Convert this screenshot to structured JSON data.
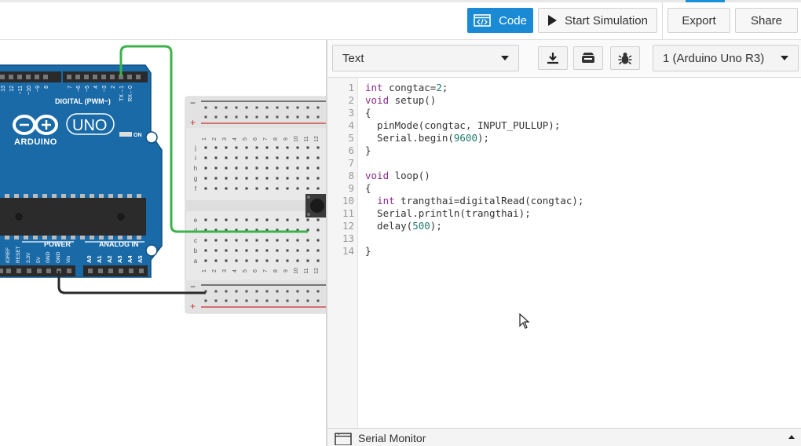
{
  "toolbar": {
    "code_label": "Code",
    "start_sim_label": "Start Simulation",
    "export_label": "Export",
    "share_label": "Share"
  },
  "editor_bar": {
    "mode_selected": "Text",
    "board_selected": "1 (Arduino Uno R3)",
    "icons": [
      "download-icon",
      "library-icon",
      "debugger-bug-icon"
    ]
  },
  "code": {
    "line_numbers": [
      "1",
      "2",
      "3",
      "4",
      "5",
      "6",
      "7",
      "8",
      "9",
      "10",
      "11",
      "12",
      "13",
      "14"
    ]
  },
  "serial_monitor": {
    "label": "Serial Monitor"
  },
  "board": {
    "logo_text": "ARDUINO",
    "model": "UNO",
    "on_label": "ON",
    "digital_label": "DIGITAL (PWM~)",
    "power_label": "POWER",
    "analog_label": "ANALOG IN",
    "digital_pins": [
      "13",
      "12",
      "~11",
      "~10",
      "~9",
      "8",
      "7",
      "~6",
      "~5",
      "4",
      "~3",
      "2",
      "TX→1",
      "RX←0"
    ],
    "power_pins": [
      "IOREF",
      "RESET",
      "3.3V",
      "5V",
      "GND",
      "GND",
      "Vin"
    ],
    "analog_pins": [
      "A0",
      "A1",
      "A2",
      "A3",
      "A4",
      "A5"
    ]
  },
  "breadboard": {
    "rail_minus": "−",
    "rail_plus": "+",
    "row_letters_top": [
      "j",
      "i",
      "h",
      "g",
      "f"
    ],
    "row_letters_bottom": [
      "e",
      "d",
      "c",
      "b",
      "a"
    ],
    "columns": [
      "1",
      "2",
      "3",
      "4",
      "5",
      "6",
      "7",
      "8",
      "9",
      "10",
      "11",
      "12"
    ]
  },
  "colors": {
    "accent": "#1a8ad4",
    "board_blue": "#1a6aa8",
    "wire_green": "#3bb34a",
    "wire_black": "#2a2a2a"
  }
}
